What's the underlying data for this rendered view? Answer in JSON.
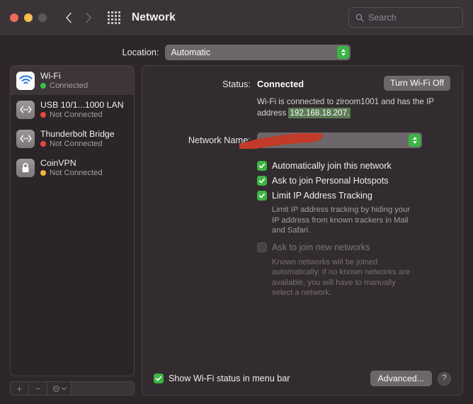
{
  "titlebar": {
    "title": "Network",
    "back_icon": "chevron-left-icon",
    "forward_icon": "chevron-right-icon",
    "grid_icon": "apps-grid-icon",
    "search_placeholder": "Search",
    "search_value": "",
    "search_icon": "search-icon"
  },
  "location": {
    "label": "Location:",
    "value": "Automatic"
  },
  "sidebar": {
    "services": [
      {
        "name": "Wi-Fi",
        "status": "Connected",
        "dot": "green",
        "icon": "wifi-icon",
        "selected": true
      },
      {
        "name": "USB 10/1...1000 LAN",
        "status": "Not Connected",
        "dot": "red",
        "icon": "ethernet-icon",
        "selected": false
      },
      {
        "name": "Thunderbolt Bridge",
        "status": "Not Connected",
        "dot": "red",
        "icon": "ethernet-icon",
        "selected": false
      },
      {
        "name": "CoinVPN",
        "status": "Not Connected",
        "dot": "amber",
        "icon": "lock-icon",
        "selected": false
      }
    ],
    "toolbar": {
      "add_label": "+",
      "remove_label": "−",
      "action_icon": "gear-icon"
    }
  },
  "main": {
    "status_label": "Status:",
    "status_value": "Connected",
    "turn_wifi_off_label": "Turn Wi-Fi Off",
    "status_desc_prefix": "Wi-Fi is connected to ziroom1001 and has the IP address ",
    "status_desc_ip": "192.168.18.207.",
    "network_name_label": "Network Name:",
    "network_name_value": "ziroom1001",
    "checkboxes": [
      {
        "label": "Automatically join this network",
        "checked": true,
        "enabled": true,
        "help": ""
      },
      {
        "label": "Ask to join Personal Hotspots",
        "checked": true,
        "enabled": true,
        "help": ""
      },
      {
        "label": "Limit IP Address Tracking",
        "checked": true,
        "enabled": true,
        "help": "Limit IP address tracking by hiding your IP address from known trackers in Mail and Safari."
      },
      {
        "label": "Ask to join new networks",
        "checked": false,
        "enabled": false,
        "help": "Known networks will be joined automatically. If no known networks are available, you will have to manually select a network."
      }
    ],
    "show_status_label": "Show Wi-Fi status in menu bar",
    "show_status_checked": true,
    "advanced_label": "Advanced...",
    "help_label": "?"
  },
  "colors": {
    "window_bg": "#2e2729",
    "titlebar_bg": "#3a3438",
    "panel_bg": "#322b2f",
    "accent_green": "#3cb543",
    "ip_highlight": "#5b7a53",
    "redaction_red": "#c23a28",
    "dot_green": "#3bc14a",
    "dot_red": "#e8483c",
    "dot_amber": "#f0b440"
  }
}
